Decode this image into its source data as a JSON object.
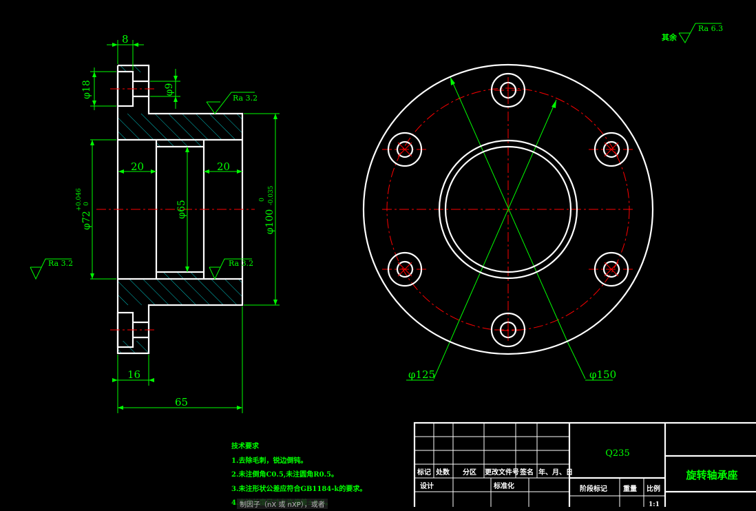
{
  "colors": {
    "outline": "#ffffff",
    "dimension": "#00ff00",
    "centerline": "#ff0000",
    "hatch": "#00c8c8",
    "background": "#000000"
  },
  "dims": {
    "top_width": "8",
    "dia18": "φ18",
    "dia9": "φ9",
    "ra_top": "Ra 3.2",
    "left_20": "20",
    "right_20": "20",
    "dia65": "φ65",
    "dia72": "φ72",
    "dia72_tol_upper": "+0.046",
    "dia72_tol_lower": "0",
    "dia100": "φ100",
    "dia100_tol_upper": "0",
    "dia100_tol_lower": "-0.035",
    "ra_left": "Ra 3.2",
    "ra_bottom": "Ra 3.2",
    "bottom_16": "16",
    "bottom_65": "65",
    "dia125": "φ125",
    "dia150": "φ150"
  },
  "surface_note": {
    "prefix": "其余",
    "value": "Ra 6.3"
  },
  "tech_requirements": {
    "title": "技术要求",
    "items": [
      "1.去除毛刺，锐边倒钝。",
      "2.未注倒角C0.5,未注圆角R0.5。",
      "3.未注形状公差应符合GB1184-k的要求。",
      "4.未注长度尺寸允许偏差±0.5。"
    ]
  },
  "overlay_text": "制因子（nX 或 nXP），或者",
  "title_block": {
    "material": "Q235",
    "part_name": "旋转轴承座",
    "headers": [
      "标记",
      "处数",
      "分区",
      "更改文件号",
      "签名",
      "年、月、日"
    ],
    "row_design": "设计",
    "row_standard": "标准化",
    "stage_mark": "阶段标记",
    "weight": "重量",
    "scale_label": "比例",
    "scale_value": "1:1"
  }
}
